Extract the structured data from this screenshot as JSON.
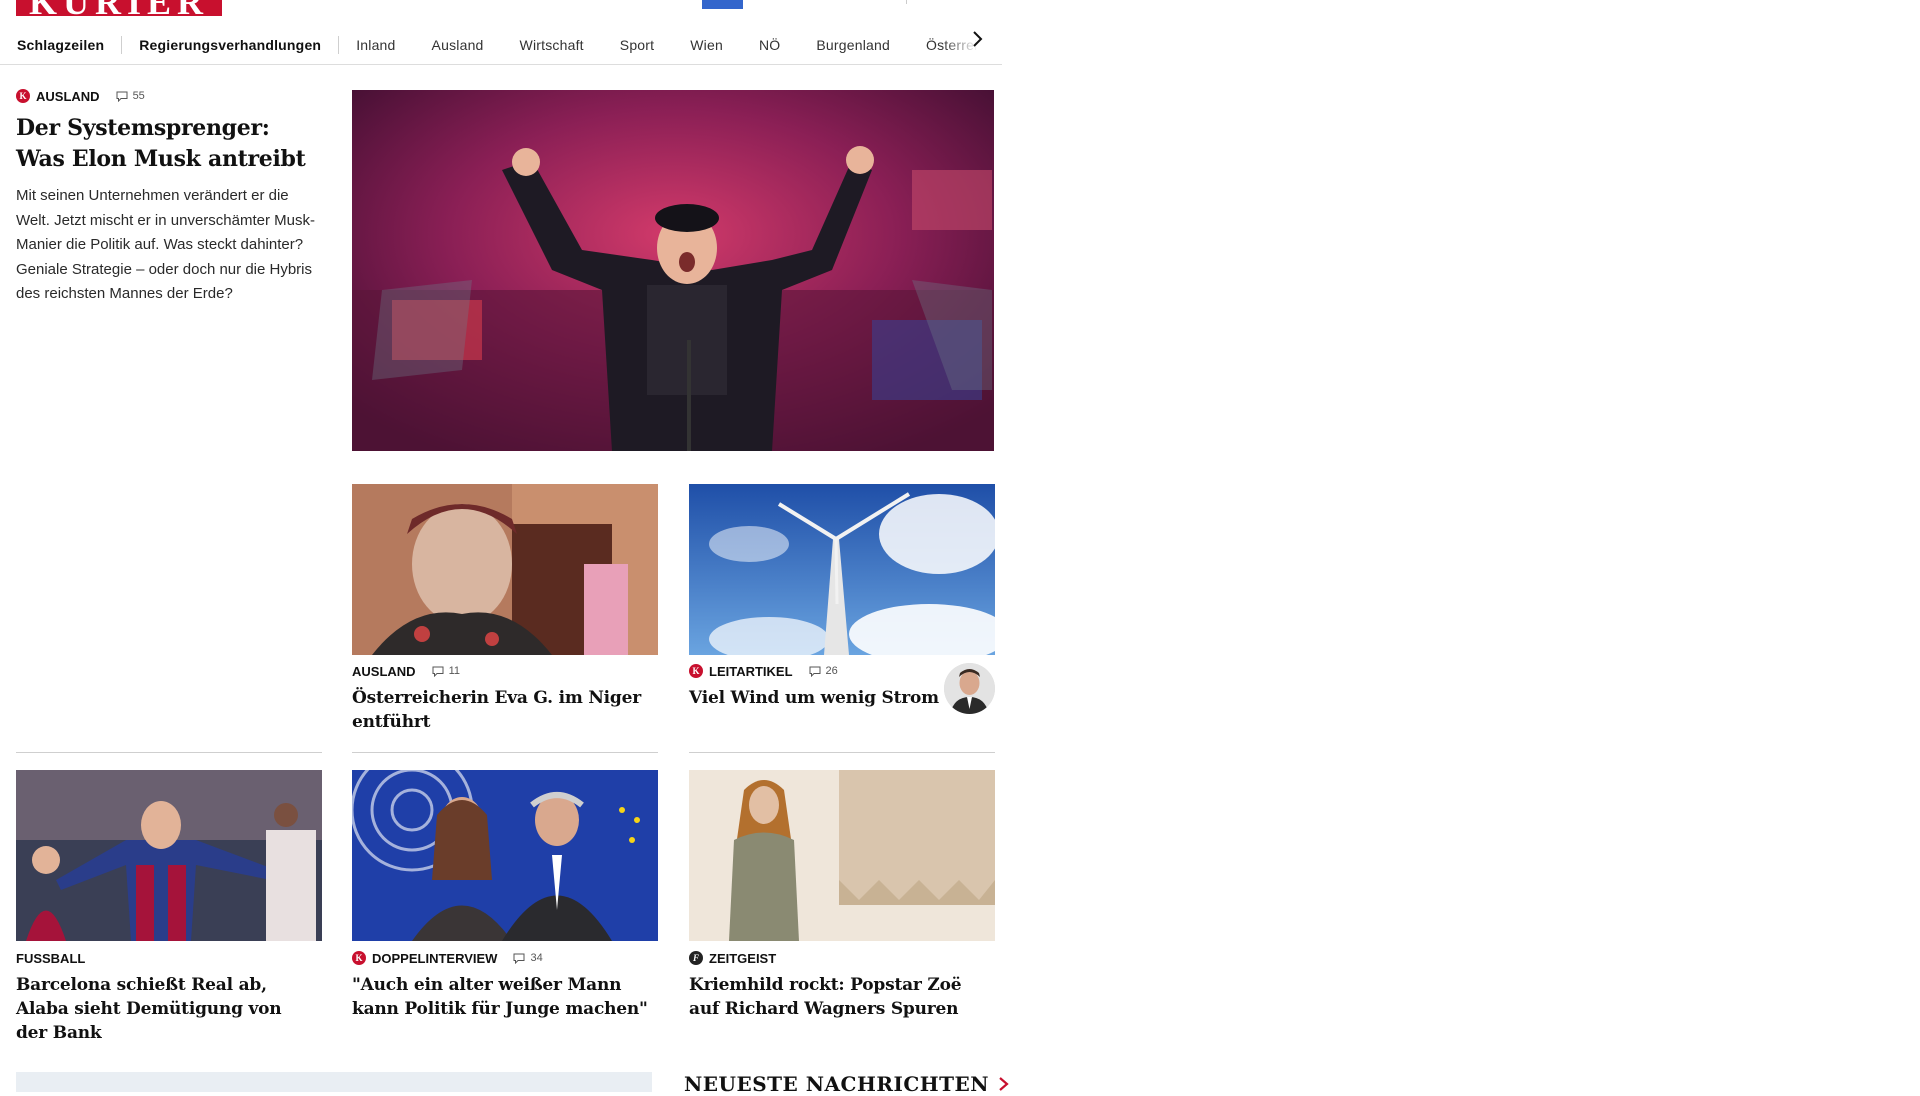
{
  "header": {
    "logo_text": "KURIER",
    "nav": {
      "items": [
        "Schlagzeilen",
        "Regierungsverhandlungen",
        "Inland",
        "Ausland",
        "Wirtschaft",
        "Sport",
        "Wien",
        "NÖ",
        "Burgenland",
        "Österreich"
      ],
      "next_icon": "chevron-right-icon"
    }
  },
  "lead": {
    "category": "AUSLAND",
    "badge": "K",
    "comments": "55",
    "headline": "Der Systemsprenger: Was Elon Musk antreibt",
    "teaser": "Mit seinen Unternehmen verändert er die Welt. Jetzt mischt er in unverschämter Musk-Manier die Politik auf. Was steckt dahinter? Geniale Strategie – oder doch nur die Hybris des reichsten Mannes der Erde?"
  },
  "cards": [
    {
      "category": "AUSLAND",
      "comments": "11",
      "headline": "Österreicherin Eva G. im Niger entführt"
    },
    {
      "category": "LEITARTIKEL",
      "badge": "K",
      "comments": "26",
      "headline": "Viel Wind um wenig Strom"
    },
    {
      "category": "FUSSBALL",
      "headline": "Barcelona schießt Real ab, Alaba sieht Demütigung von der Bank"
    },
    {
      "category": "DOPPELINTERVIEW",
      "badge": "K",
      "comments": "34",
      "headline": "\"Auch ein alter weißer Mann kann Politik für Junge machen\""
    },
    {
      "category": "ZEITGEIST",
      "badge": "f",
      "headline": "Kriemhild rockt: Popstar Zoë auf Richard Wagners Spuren"
    }
  ],
  "section": {
    "neueste_label": "NEUESTE NACHRICHTEN"
  },
  "colors": {
    "brand_red": "#c8102e",
    "accent_blue": "#3366cc"
  }
}
